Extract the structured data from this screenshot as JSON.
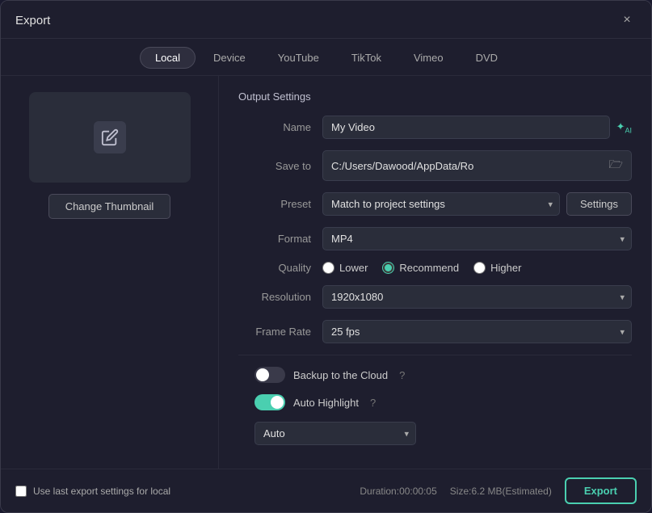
{
  "dialog": {
    "title": "Export",
    "close_label": "×"
  },
  "tabs": [
    {
      "id": "local",
      "label": "Local",
      "active": true
    },
    {
      "id": "device",
      "label": "Device",
      "active": false
    },
    {
      "id": "youtube",
      "label": "YouTube",
      "active": false
    },
    {
      "id": "tiktok",
      "label": "TikTok",
      "active": false
    },
    {
      "id": "vimeo",
      "label": "Vimeo",
      "active": false
    },
    {
      "id": "dvd",
      "label": "DVD",
      "active": false
    }
  ],
  "thumbnail": {
    "change_label": "Change Thumbnail"
  },
  "output_settings": {
    "section_title": "Output Settings",
    "name_label": "Name",
    "name_value": "My Video",
    "save_to_label": "Save to",
    "save_to_value": "C:/Users/Dawood/AppData/Ro",
    "preset_label": "Preset",
    "preset_value": "Match to project settings",
    "settings_btn": "Settings",
    "format_label": "Format",
    "format_value": "MP4",
    "quality_label": "Quality",
    "quality_options": [
      {
        "id": "lower",
        "label": "Lower",
        "checked": false
      },
      {
        "id": "recommend",
        "label": "Recommend",
        "checked": true
      },
      {
        "id": "higher",
        "label": "Higher",
        "checked": false
      }
    ],
    "resolution_label": "Resolution",
    "resolution_value": "1920x1080",
    "frame_rate_label": "Frame Rate",
    "frame_rate_value": "25 fps",
    "backup_label": "Backup to the Cloud",
    "backup_on": false,
    "auto_highlight_label": "Auto Highlight",
    "auto_highlight_on": true,
    "auto_label": "Auto"
  },
  "footer": {
    "checkbox_label": "Use last export settings for local",
    "duration": "Duration:00:00:05",
    "size": "Size:6.2 MB(Estimated)",
    "export_btn": "Export"
  }
}
